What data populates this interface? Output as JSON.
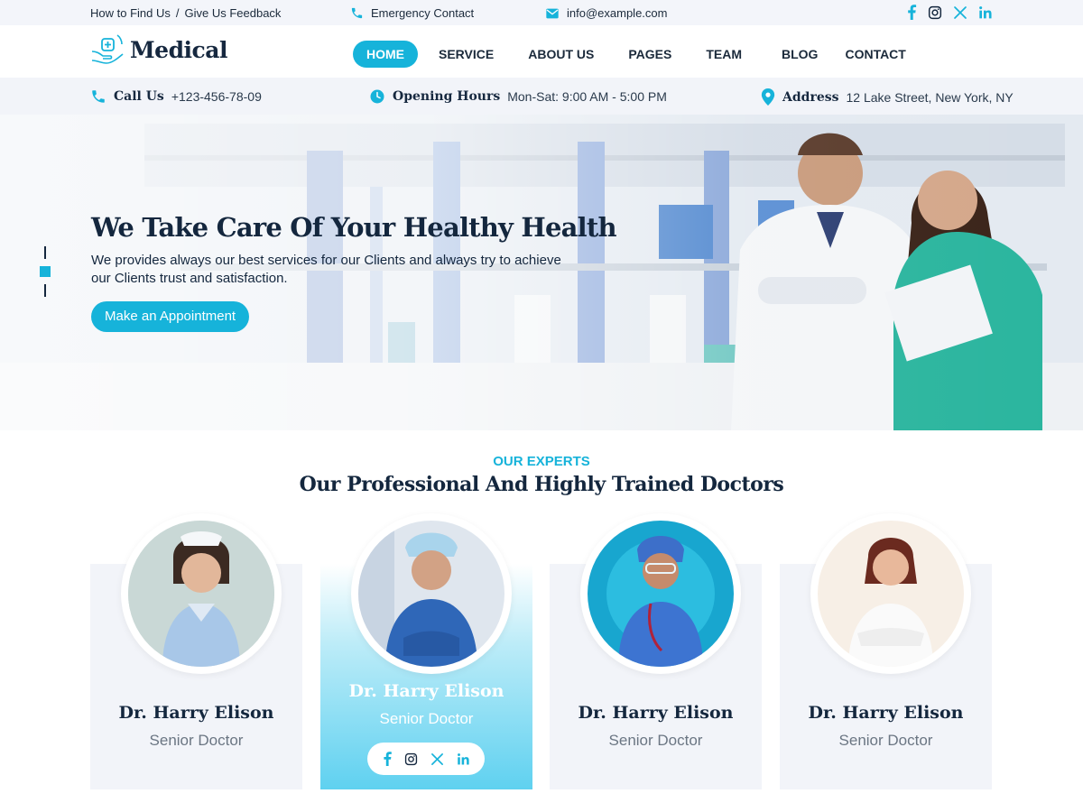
{
  "topbar": {
    "find_us": "How to Find Us",
    "separator": "/",
    "feedback": "Give Us Feedback",
    "emergency": "Emergency Contact",
    "email": "info@example.com",
    "social_icons": [
      "facebook-icon",
      "instagram-icon",
      "x-icon",
      "linkedin-icon"
    ]
  },
  "brand": {
    "name": "Medical"
  },
  "nav": {
    "items": [
      {
        "label": "HOME",
        "active": true
      },
      {
        "label": "SERVICE"
      },
      {
        "label": "ABOUT US"
      },
      {
        "label": "PAGES"
      },
      {
        "label": "TEAM"
      },
      {
        "label": "BLOG"
      },
      {
        "label": "CONTACT"
      }
    ]
  },
  "infobar": {
    "call_label": "Call Us",
    "call_value": "+123-456-78-09",
    "hours_label": "Opening Hours",
    "hours_value": "Mon-Sat: 9:00 AM - 5:00 PM",
    "address_label": "Address",
    "address_value": "12 Lake Street, New York, NY"
  },
  "hero": {
    "title": "We Take Care Of  Your Healthy Health",
    "text": "We provides always our best services for our Clients and always try to achieve our Clients trust and satisfaction.",
    "button": "Make an Appointment"
  },
  "experts": {
    "subtitle": "OUR EXPERTS",
    "title": "Our Professional And Highly Trained Doctors",
    "doctors": [
      {
        "name": "Dr. Harry Elison",
        "role": "Senior Doctor"
      },
      {
        "name": "Dr. Harry Elison",
        "role": "Senior Doctor"
      },
      {
        "name": "Dr. Harry Elison",
        "role": "Senior Doctor"
      },
      {
        "name": "Dr. Harry Elison",
        "role": "Senior Doctor"
      }
    ]
  },
  "colors": {
    "accent": "#16b3da",
    "dark": "#14273e",
    "light_bg": "#f2f4f9"
  }
}
